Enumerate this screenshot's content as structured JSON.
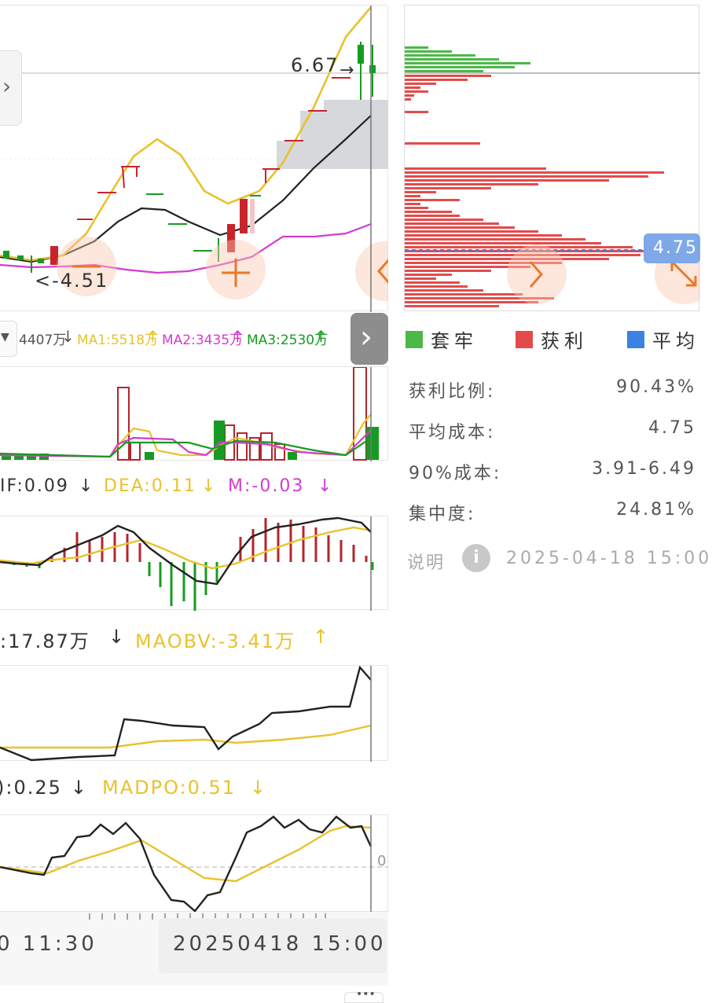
{
  "main_chart": {
    "high_label": "6.67",
    "low_label": "<-4.51",
    "ma_line_colors": {
      "ma_short": "#e9c22c",
      "ma_mid": "#222222",
      "ma_long": "#d43bd0"
    }
  },
  "volume_header": {
    "vol": "4407万",
    "ma1": "MA1:5518万",
    "ma2": "MA2:3435万",
    "ma3": "MA3:2530万"
  },
  "macd_header": {
    "dif": "IF:0.09",
    "dea": "DEA:0.11",
    "m": "M:-0.03"
  },
  "obv_header": {
    "obv": ":17.87万",
    "maobv": "MAOBV:-3.41万"
  },
  "dpo_header": {
    "dpo": "):0.25",
    "madpo": "MADPO:0.51",
    "zero": "0"
  },
  "time_axis": {
    "left_time": "0 11:30",
    "cursor_time": "20250418 15:00"
  },
  "chip_panel": {
    "price_tag": "4.75",
    "legend": [
      {
        "label": "套牢",
        "color": "#4cb848"
      },
      {
        "label": "获利",
        "color": "#e34b4b"
      },
      {
        "label": "平均",
        "color": "#3a83e0"
      }
    ],
    "stats": [
      {
        "label": "获利比例:",
        "value": "90.43%"
      },
      {
        "label": "平均成本:",
        "value": "4.75"
      },
      {
        "label": "90%成本:",
        "value": "3.91-6.49"
      },
      {
        "label": "集中度:",
        "value": "24.81%"
      }
    ],
    "note_label": "说明",
    "timestamp": "2025-04-18 15:00"
  },
  "colors": {
    "up": "#c8242b",
    "down": "#169b22",
    "accent": "#e9c22c",
    "cursor": "#777777",
    "orange": "#e8782a"
  }
}
